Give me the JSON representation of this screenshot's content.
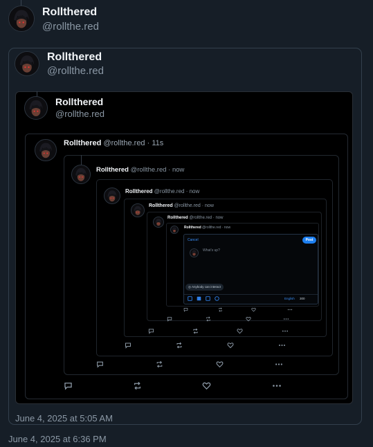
{
  "accent": "#1d7ff0",
  "top_post": {
    "name": "Rollthered",
    "handle": "@rollthe.red",
    "timestamp": "June 4, 2025 at 6:36 PM"
  },
  "quote1": {
    "name": "Rollthered",
    "handle": "@rollthe.red",
    "timestamp": "June 4, 2025 at 5:05 AM"
  },
  "quote2": {
    "name": "Rollthered",
    "handle": "@rollthe.red"
  },
  "quote3": {
    "name": "Rollthered",
    "meta": "@rollthe.red · 11s"
  },
  "quote4": {
    "name": "Rollthered",
    "meta": "@rollthe.red · now"
  },
  "quote5": {
    "name": "Rollthered",
    "meta": "@rollthe.red · now"
  },
  "quote6": {
    "name": "Rollthered",
    "meta": "@rollthe.red · now"
  },
  "quote7": {
    "name": "Rollthered",
    "meta": "@rollthe.red · now"
  },
  "quote8": {
    "name": "Rollthered",
    "meta": "@rollthe.red · now"
  },
  "composer": {
    "cancel": "Cancel",
    "post": "Post",
    "placeholder": "What's up?",
    "interact": "Anybody can interact",
    "language": "English",
    "char_count": "300"
  },
  "icons": [
    "reply-icon",
    "repost-icon",
    "like-icon",
    "more-icon",
    "image-icon",
    "gif-icon",
    "emoji-icon",
    "globe-icon"
  ]
}
